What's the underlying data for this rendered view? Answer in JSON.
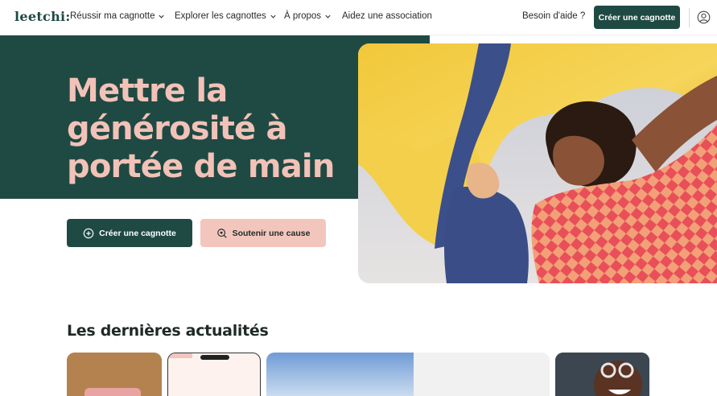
{
  "header": {
    "logo": "leetchi:",
    "nav": [
      {
        "label": "Réussir ma cagnotte",
        "has_menu": true
      },
      {
        "label": "Explorer les cagnottes",
        "has_menu": true
      },
      {
        "label": "À propos",
        "has_menu": true
      },
      {
        "label": "Aidez une association",
        "has_menu": false
      }
    ],
    "help": "Besoin d'aide ?",
    "cta": "Créer une cagnotte",
    "account_icon": "user-circle-icon"
  },
  "hero": {
    "title": "Mettre la générosité à portée de main",
    "primary_button": "Créer une cagnotte",
    "secondary_button": "Soutenir une cause",
    "image_icon": "woman-yellow-fabric-photo"
  },
  "news": {
    "title": "Les dernières actualités"
  },
  "colors": {
    "brand_green": "#1f4a43",
    "brand_pink": "#f2c2b8",
    "button_pink": "#f3c6bd"
  }
}
